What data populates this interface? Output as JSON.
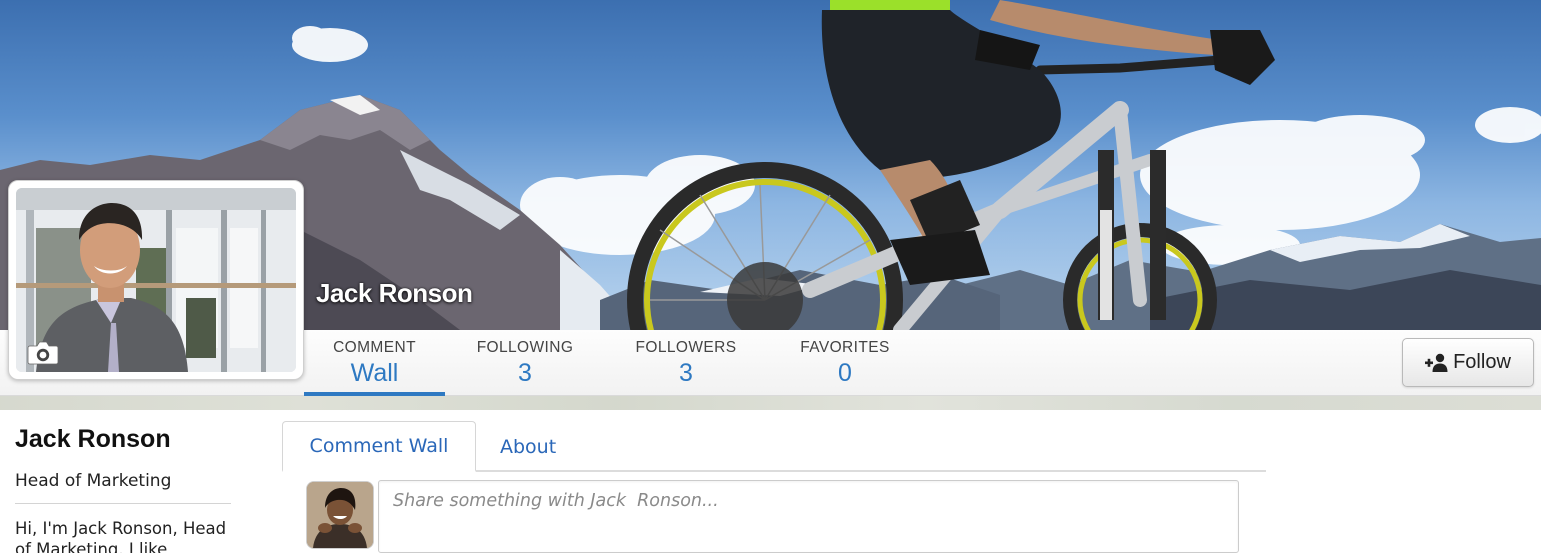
{
  "profile": {
    "cover_name": "Jack Ronson",
    "name": "Jack Ronson",
    "title": "Head of Marketing",
    "bio": "Hi, I'm Jack Ronson, Head of Marketing. I like"
  },
  "stats": [
    {
      "label": "COMMENT",
      "value": "Wall"
    },
    {
      "label": "FOLLOWING",
      "value": "3"
    },
    {
      "label": "FOLLOWERS",
      "value": "3"
    },
    {
      "label": "FAVORITES",
      "value": "0"
    }
  ],
  "follow": {
    "label": "Follow",
    "icon": "user-plus-icon"
  },
  "tabs": [
    {
      "label": "Comment Wall",
      "active": true
    },
    {
      "label": "About",
      "active": false
    }
  ],
  "composer": {
    "placeholder": "Share something with Jack  Ronson..."
  },
  "colors": {
    "accent": "#2e79c2",
    "link": "#2a67b8"
  },
  "icons": {
    "camera": "camera-icon",
    "follow": "user-plus-icon"
  }
}
